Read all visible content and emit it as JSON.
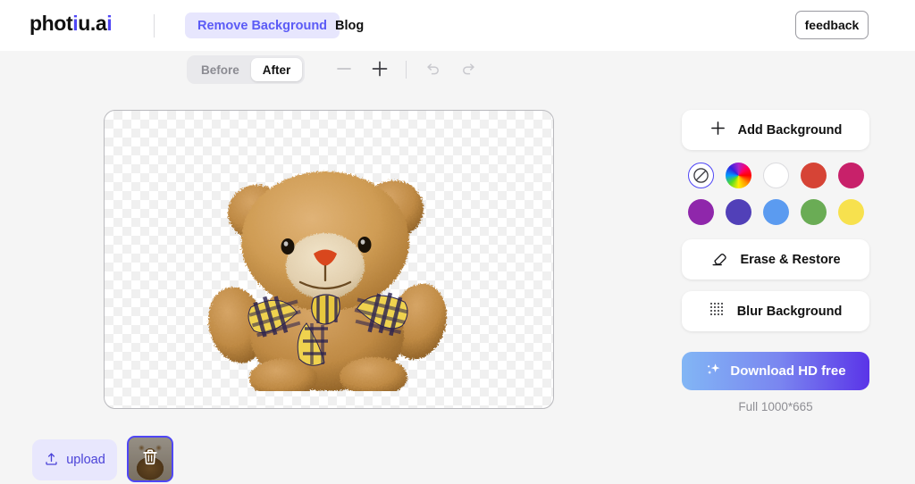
{
  "header": {
    "logo_main": "phot",
    "logo_i": "i",
    "logo_u": "u.a",
    "logo_last_i": "i",
    "logo_full": "photiu.ai",
    "nav_remove_background": "Remove Background",
    "nav_blog": "Blog",
    "feedback_label": "feedback"
  },
  "toolbar": {
    "before_label": "Before",
    "after_label": "After",
    "active_segment": "After",
    "zoom_out_icon": "minus-icon",
    "zoom_in_icon": "plus-icon",
    "undo_icon": "undo-icon",
    "redo_icon": "redo-icon"
  },
  "canvas": {
    "image_alt": "teddy-bear-transparent",
    "background_state": "transparent-checkerboard"
  },
  "panel": {
    "add_background_label": "Add Background",
    "add_background_icon": "plus-icon",
    "erase_restore_label": "Erase & Restore",
    "erase_restore_icon": "eraser-icon",
    "blur_background_label": "Blur Background",
    "blur_background_icon": "blur-grid-icon",
    "download_label": "Download HD free",
    "download_icon": "sparkle-icon",
    "size_label": "Full 1000*665",
    "swatches": [
      {
        "name": "none",
        "label": "no-background",
        "color": "#ffffff",
        "selected": true
      },
      {
        "name": "wheel",
        "label": "color-picker",
        "color": "rainbow",
        "selected": false
      },
      {
        "name": "white",
        "label": "white",
        "color": "#ffffff",
        "selected": false
      },
      {
        "name": "red",
        "label": "red",
        "color": "#d64436",
        "selected": false
      },
      {
        "name": "crimson",
        "label": "crimson",
        "color": "#c8216a",
        "selected": false
      },
      {
        "name": "purple",
        "label": "purple",
        "color": "#8f27ab",
        "selected": false
      },
      {
        "name": "indigo",
        "label": "indigo",
        "color": "#5140b8",
        "selected": false
      },
      {
        "name": "blue",
        "label": "blue",
        "color": "#5b9bf0",
        "selected": false
      },
      {
        "name": "green",
        "label": "green",
        "color": "#6aac55",
        "selected": false
      },
      {
        "name": "yellow",
        "label": "yellow",
        "color": "#f7e14e",
        "selected": false
      }
    ]
  },
  "bottom": {
    "upload_label": "upload",
    "upload_icon": "upload-icon",
    "thumbnail_name": "teddy-bear-original",
    "thumbnail_delete_icon": "trash-icon"
  },
  "colors": {
    "accent": "#4f46f5",
    "accent_soft": "#e7e6fd",
    "page_bg": "#f5f5f5",
    "header_bg": "#ffffff"
  }
}
